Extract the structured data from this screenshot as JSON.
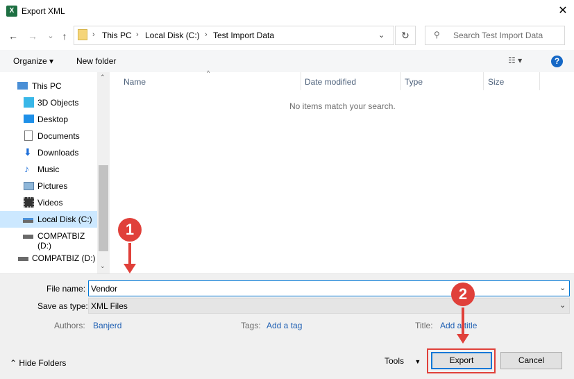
{
  "window": {
    "title": "Export XML"
  },
  "nav": {
    "back": "←",
    "forward": "→",
    "recent": "⌄",
    "up": "↑"
  },
  "address": {
    "crumbs": [
      "This PC",
      "Local Disk (C:)",
      "Test Import Data"
    ]
  },
  "search": {
    "placeholder": "Search Test Import Data"
  },
  "toolbar": {
    "organize": "Organize ▾",
    "new_folder": "New folder",
    "help": "?"
  },
  "sidebar": {
    "items": [
      {
        "label": "This PC",
        "icon": "computer-icon"
      },
      {
        "label": "3D Objects",
        "icon": "cube-icon"
      },
      {
        "label": "Desktop",
        "icon": "desktop-icon"
      },
      {
        "label": "Documents",
        "icon": "document-icon"
      },
      {
        "label": "Downloads",
        "icon": "download-icon"
      },
      {
        "label": "Music",
        "icon": "music-icon"
      },
      {
        "label": "Pictures",
        "icon": "picture-icon"
      },
      {
        "label": "Videos",
        "icon": "video-icon"
      },
      {
        "label": "Local Disk (C:)",
        "icon": "drive-icon",
        "selected": true
      },
      {
        "label": "COMPATBIZ (D:)",
        "icon": "drive-icon"
      },
      {
        "label": "COMPATBIZ (D:)",
        "icon": "drive-icon"
      }
    ]
  },
  "columns": [
    "Name",
    "Date modified",
    "Type",
    "Size"
  ],
  "empty_message": "No items match your search.",
  "form": {
    "file_name_label": "File name:",
    "file_name_value": "Vendor",
    "save_type_label": "Save as type:",
    "save_type_value": "XML Files",
    "authors_label": "Authors:",
    "authors_value": "Banjerd",
    "tags_label": "Tags:",
    "tags_value": "Add a tag",
    "title_label": "Title:",
    "title_value": "Add a title"
  },
  "footer": {
    "hide_folders": "Hide Folders",
    "tools": "Tools",
    "export": "Export",
    "cancel": "Cancel"
  },
  "annotations": {
    "step1": "1",
    "step2": "2"
  },
  "colors": {
    "accent": "#0078d7",
    "annotation": "#e0403a",
    "selected": "#cce8ff"
  }
}
